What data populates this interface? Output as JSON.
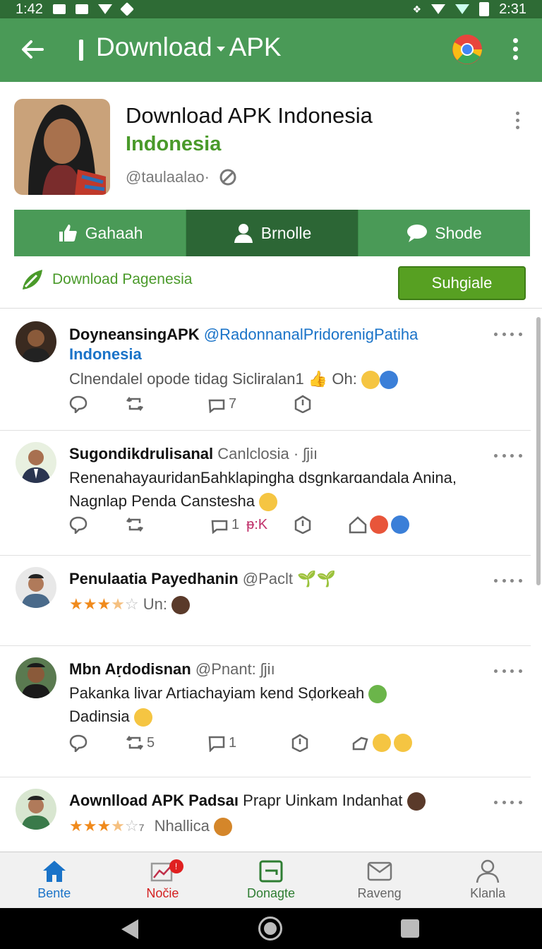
{
  "status_bar": {
    "time_left": "1:42",
    "time_right": "2:31"
  },
  "app_bar": {
    "title_part1": "Download",
    "title_part2": "APK"
  },
  "profile": {
    "name": "Download APK Indonesia",
    "subtitle": "Indonesia",
    "handle": "@taulaalao·"
  },
  "action_tabs": [
    {
      "label": "Gahaah",
      "icon": "thumbs-up-icon"
    },
    {
      "label": "Brnolle",
      "icon": "person-icon"
    },
    {
      "label": "Shode",
      "icon": "chat-bubble-icon"
    }
  ],
  "download_link": {
    "label": "Download Pagenesia"
  },
  "suggest_button": {
    "label": "Suhgiale"
  },
  "posts": [
    {
      "author": "DoyneansingAPK",
      "mention": "@RadonnanalPridorenigPatiha",
      "line2": "Indonesia",
      "text": "Clnendalel opode tidag Sicliralan1",
      "text_tail": "Oh:",
      "actions": {
        "retweet_count": "",
        "quote_count": "7"
      }
    },
    {
      "author": "Sugondikdrulisanal",
      "handle": "Canlclosia · ʃjiı",
      "text": "RenenahayauridanБahklapingha dsgnkarɑandala Anina, Nagnlap Penda Canstesha",
      "actions": {
        "quote_count": "1",
        "extra": "ᵽ:K"
      }
    },
    {
      "author": "Penulaatia Payedhanin",
      "handle": "@Paclt",
      "rating_label": "Un:"
    },
    {
      "author": "Mbn Aṛdodisnan",
      "handle": "@Pnant: ʃjiı",
      "text": "Pakanka livar Artiachayiam kend Sḍorkeah",
      "text2": "Dadinsia",
      "actions": {
        "retweet_count": "5",
        "reply_count": "1"
      }
    },
    {
      "author": "Aownlload APK Padsaı",
      "handle": "Prapr Uinkam Indanhat",
      "rating_suffix": "7",
      "rating_label": "Nhallica"
    }
  ],
  "bottom_nav": [
    {
      "label": "Bente",
      "color": "#1a73c8"
    },
    {
      "label": "Nočie",
      "color": "#d42020",
      "badge": "!"
    },
    {
      "label": "Donagte",
      "color": "#2e7d32"
    },
    {
      "label": "Raveng",
      "color": "#666666"
    },
    {
      "label": "Klanla",
      "color": "#666666"
    }
  ],
  "colors": {
    "app_bar": "#4a9a57",
    "status_bar": "#2e6b35",
    "accent_green": "#57a022",
    "link_blue": "#1a73c8"
  }
}
